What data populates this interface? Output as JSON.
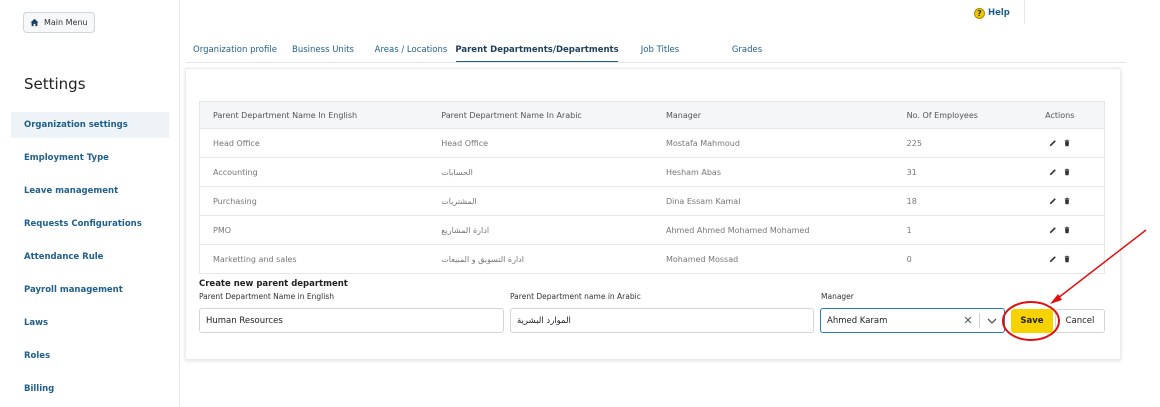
{
  "sidebar": {
    "main_menu_label": "Main Menu",
    "title": "Settings",
    "items": [
      {
        "label": "Organization settings"
      },
      {
        "label": "Employment Type"
      },
      {
        "label": "Leave management"
      },
      {
        "label": "Requests Configurations"
      },
      {
        "label": "Attendance Rule"
      },
      {
        "label": "Payroll management"
      },
      {
        "label": "Laws"
      },
      {
        "label": "Roles"
      },
      {
        "label": "Billing"
      }
    ]
  },
  "header": {
    "help_label": "Help",
    "help_icon": "?"
  },
  "tabs": [
    {
      "label": "Organization profile"
    },
    {
      "label": "Business Units"
    },
    {
      "label": "Areas / Locations"
    },
    {
      "label": "Parent Departments/Departments"
    },
    {
      "label": "Job Titles"
    },
    {
      "label": "Grades"
    }
  ],
  "table": {
    "columns": [
      "Parent Department Name In English",
      "Parent Department Name In Arabic",
      "Manager",
      "No. Of Employees",
      "Actions"
    ],
    "rows": [
      {
        "english": "Head Office",
        "arabic": "Head Office",
        "manager": "Mostafa Mahmoud",
        "employees": "225"
      },
      {
        "english": "Accounting",
        "arabic": "الحسابات",
        "manager": "Hesham Abas",
        "employees": "31"
      },
      {
        "english": "Purchasing",
        "arabic": "المشتريات",
        "manager": "Dina Essam Kamal",
        "employees": "18"
      },
      {
        "english": "PMO",
        "arabic": "ادارة المشاريع",
        "manager": "Ahmed Ahmed Mohamed Mohamed",
        "employees": "1"
      },
      {
        "english": "Marketting and sales",
        "arabic": "ادارة التسويق و المبيعات",
        "manager": "Mohamed Mossad",
        "employees": "0"
      }
    ]
  },
  "form": {
    "title": "Create new parent department",
    "english_label": "Parent Department Name in English",
    "english_value": "Human Resources",
    "arabic_label": "Parent Department name in Arabic",
    "arabic_value": "الموارد البشرية",
    "manager_label": "Manager",
    "manager_value": "Ahmed Karam",
    "clear_glyph": "✕",
    "save_label": "Save",
    "cancel_label": "Cancel"
  },
  "colors": {
    "accent": "#1f5f8b",
    "save_button": "#f6d200",
    "annotation": "#e01010"
  }
}
